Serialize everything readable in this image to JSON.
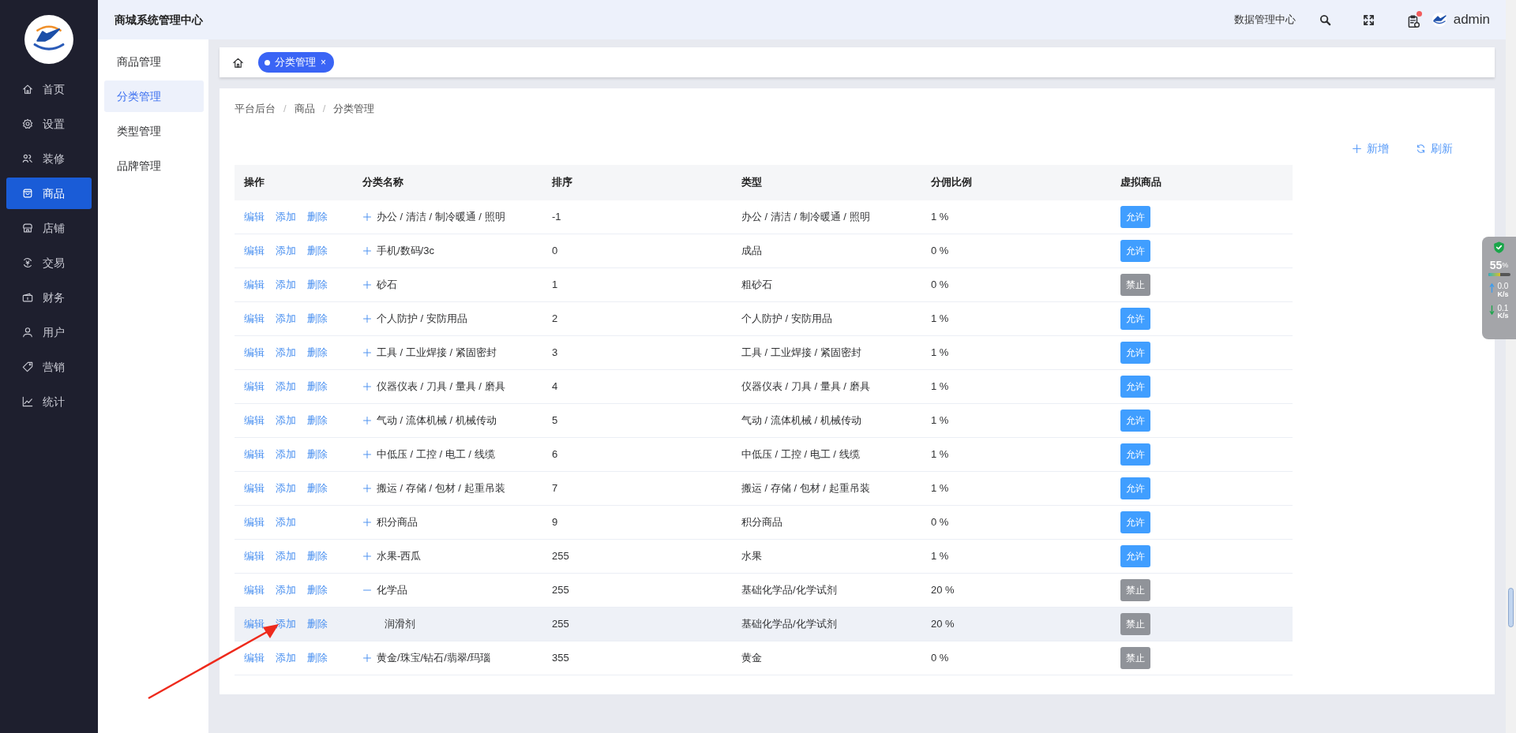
{
  "sidebar": {
    "items": [
      {
        "label": "首页",
        "selected": false
      },
      {
        "label": "设置",
        "selected": false
      },
      {
        "label": "装修",
        "selected": false
      },
      {
        "label": "商品",
        "selected": true
      },
      {
        "label": "店铺",
        "selected": false
      },
      {
        "label": "交易",
        "selected": false
      },
      {
        "label": "财务",
        "selected": false
      },
      {
        "label": "用户",
        "selected": false
      },
      {
        "label": "营销",
        "selected": false
      },
      {
        "label": "统计",
        "selected": false
      }
    ]
  },
  "header": {
    "title": "商城系统管理中心",
    "data_center": "数据管理中心",
    "notification_dot": true,
    "user": "admin"
  },
  "submenu": {
    "items": [
      {
        "label": "商品管理",
        "selected": false
      },
      {
        "label": "分类管理",
        "selected": true
      },
      {
        "label": "类型管理",
        "selected": false
      },
      {
        "label": "品牌管理",
        "selected": false
      }
    ]
  },
  "tabs": [
    {
      "label": "分类管理",
      "selected": true,
      "close": "×"
    }
  ],
  "breadcrumb": {
    "items": [
      "平台后台",
      "商品",
      "分类管理"
    ],
    "separators": [
      "/",
      "/"
    ]
  },
  "toolbar": [
    {
      "kind": "add",
      "label": "新增"
    },
    {
      "kind": "refresh",
      "label": "刷新"
    }
  ],
  "table": {
    "columns": [
      "操作",
      "分类名称",
      "排序",
      "类型",
      "分佣比例",
      "虚拟商品"
    ],
    "rows": [
      {
        "actions": [
          "编辑",
          "添加",
          "删除"
        ],
        "expanded": false,
        "hovered": false,
        "name": "办公 / 清洁 / 制冷暖通 / 照明",
        "sort": "-1",
        "type": "办公 / 清洁 / 制冷暖通 / 照明",
        "ratio": "1 %",
        "virtual": {
          "label": "允许",
          "allowed": true
        }
      },
      {
        "actions": [
          "编辑",
          "添加",
          "删除"
        ],
        "expanded": false,
        "hovered": false,
        "name": "手机/数码/3c",
        "sort": "0",
        "type": "成品",
        "ratio": "0 %",
        "virtual": {
          "label": "允许",
          "allowed": true
        }
      },
      {
        "actions": [
          "编辑",
          "添加",
          "删除"
        ],
        "expanded": false,
        "hovered": false,
        "name": "砂石",
        "sort": "1",
        "type": "粗砂石",
        "ratio": "0 %",
        "virtual": {
          "label": "禁止",
          "allowed": false
        }
      },
      {
        "actions": [
          "编辑",
          "添加",
          "删除"
        ],
        "expanded": false,
        "hovered": false,
        "name": "个人防护 / 安防用品",
        "sort": "2",
        "type": "个人防护 / 安防用品",
        "ratio": "1 %",
        "virtual": {
          "label": "允许",
          "allowed": true
        }
      },
      {
        "actions": [
          "编辑",
          "添加",
          "删除"
        ],
        "expanded": false,
        "hovered": false,
        "name": "工具 / 工业焊接 / 紧固密封",
        "sort": "3",
        "type": "工具 / 工业焊接 / 紧固密封",
        "ratio": "1 %",
        "virtual": {
          "label": "允许",
          "allowed": true
        }
      },
      {
        "actions": [
          "编辑",
          "添加",
          "删除"
        ],
        "expanded": false,
        "hovered": false,
        "name": "仪器仪表 / 刀具 / 量具 / 磨具",
        "sort": "4",
        "type": "仪器仪表 / 刀具 / 量具 / 磨具",
        "ratio": "1 %",
        "virtual": {
          "label": "允许",
          "allowed": true
        }
      },
      {
        "actions": [
          "编辑",
          "添加",
          "删除"
        ],
        "expanded": false,
        "hovered": false,
        "name": "气动 / 流体机械 / 机械传动",
        "sort": "5",
        "type": "气动 / 流体机械 / 机械传动",
        "ratio": "1 %",
        "virtual": {
          "label": "允许",
          "allowed": true
        }
      },
      {
        "actions": [
          "编辑",
          "添加",
          "删除"
        ],
        "expanded": false,
        "hovered": false,
        "name": "中低压 / 工控 / 电工 / 线缆",
        "sort": "6",
        "type": "中低压 / 工控 / 电工 / 线缆",
        "ratio": "1 %",
        "virtual": {
          "label": "允许",
          "allowed": true
        }
      },
      {
        "actions": [
          "编辑",
          "添加",
          "删除"
        ],
        "expanded": false,
        "hovered": false,
        "name": "搬运 / 存储 / 包材 / 起重吊装",
        "sort": "7",
        "type": "搬运 / 存储 / 包材 / 起重吊装",
        "ratio": "1 %",
        "virtual": {
          "label": "允许",
          "allowed": true
        }
      },
      {
        "actions": [
          "编辑",
          "添加"
        ],
        "expanded": false,
        "hovered": false,
        "name": "积分商品",
        "sort": "9",
        "type": "积分商品",
        "ratio": "0 %",
        "virtual": {
          "label": "允许",
          "allowed": true
        }
      },
      {
        "actions": [
          "编辑",
          "添加",
          "删除"
        ],
        "expanded": false,
        "hovered": false,
        "name": "水果-西瓜",
        "sort": "255",
        "type": "水果",
        "ratio": "1 %",
        "virtual": {
          "label": "允许",
          "allowed": true
        }
      },
      {
        "actions": [
          "编辑",
          "添加",
          "删除"
        ],
        "expanded": true,
        "hovered": false,
        "name": "化学品",
        "sort": "255",
        "type": "基础化学品/化学试剂",
        "ratio": "20 %",
        "virtual": {
          "label": "禁止",
          "allowed": false
        },
        "children": [
          {
            "actions": [
              "编辑",
              "添加",
              "删除"
            ],
            "hovered": true,
            "name": "润滑剂",
            "sort": "255",
            "type": "基础化学品/化学试剂",
            "ratio": "20 %",
            "virtual": {
              "label": "禁止",
              "allowed": false
            }
          }
        ]
      },
      {
        "actions": [
          "编辑",
          "添加",
          "删除"
        ],
        "expanded": false,
        "hovered": false,
        "name": "黄金/珠宝/钻石/翡翠/玛瑙",
        "sort": "355",
        "type": "黄金",
        "ratio": "0 %",
        "virtual": {
          "label": "禁止",
          "allowed": false
        }
      }
    ]
  },
  "monitor": {
    "percent": "55",
    "unit": "%",
    "level": 0.55,
    "upload": {
      "value": "0.0",
      "unit": "K/s"
    },
    "download": {
      "value": "0.1",
      "unit": "K/s"
    }
  }
}
